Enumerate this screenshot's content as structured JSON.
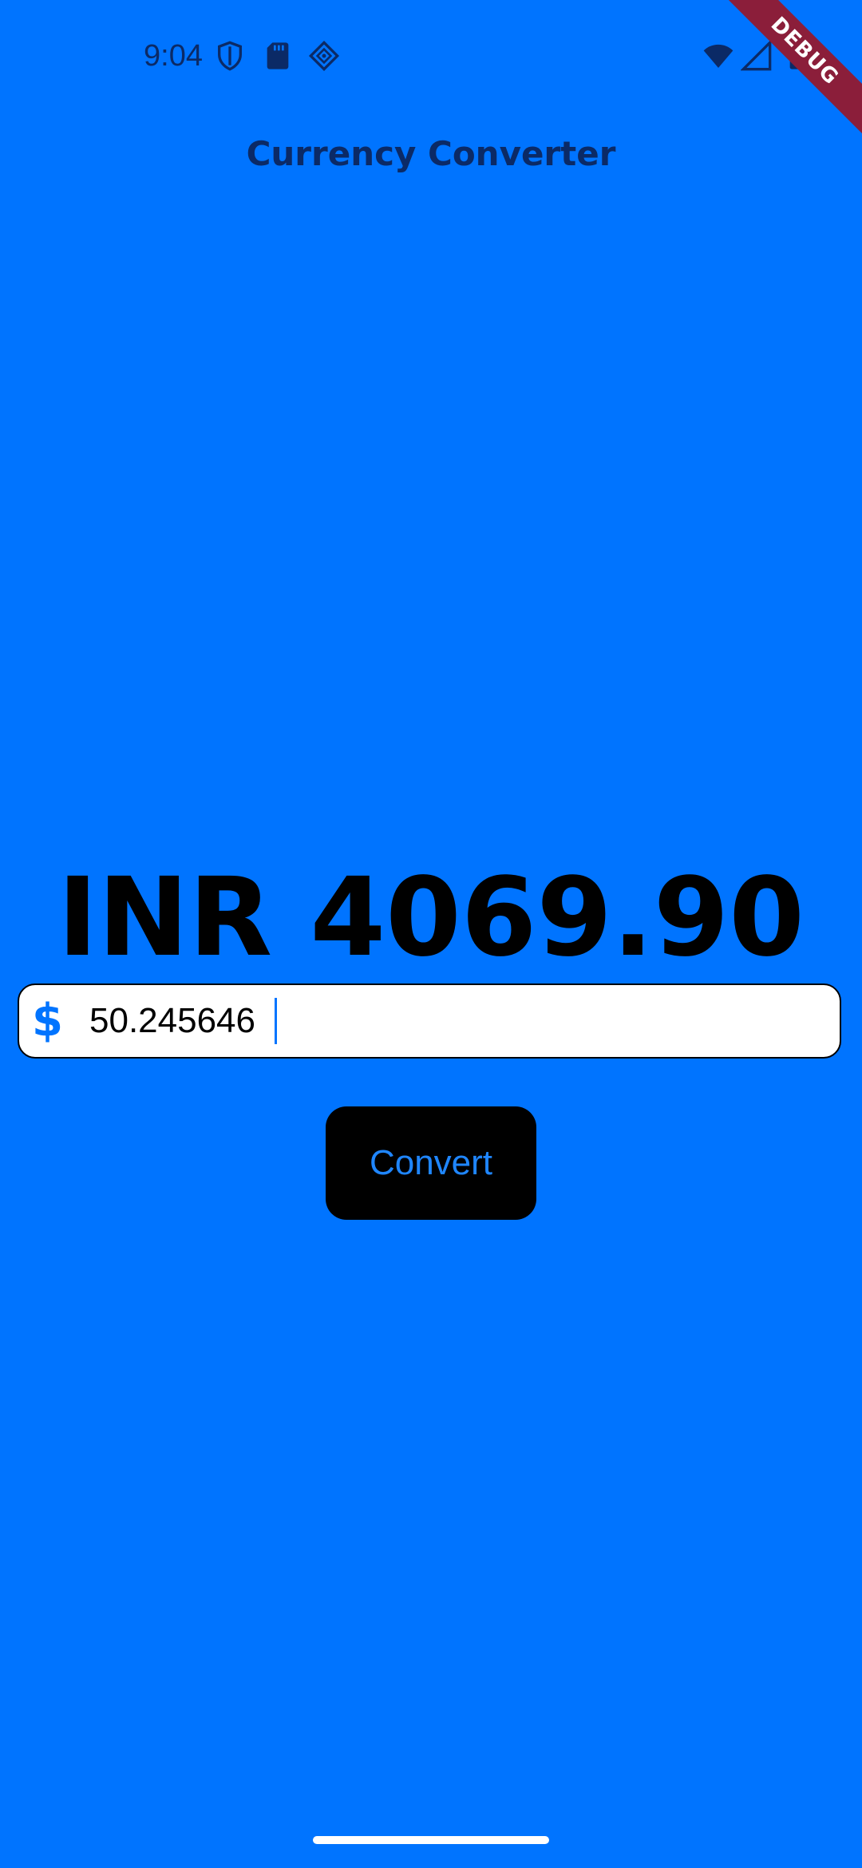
{
  "status_bar": {
    "time": "9:04",
    "icons_left": [
      "shield-icon",
      "sd-card-icon",
      "diamond-grid-icon"
    ],
    "icons_right": [
      "wifi-icon",
      "cellular-icon",
      "battery-icon"
    ]
  },
  "debug_banner": {
    "label": "DEBUG",
    "color": "#8b1e3a"
  },
  "app": {
    "title": "Currency Converter",
    "background_color": "#0074FF"
  },
  "result": {
    "text": "INR 4069.90"
  },
  "amount_field": {
    "prefix_icon": "dollar-icon",
    "prefix_symbol": "$",
    "value": "50.245646"
  },
  "convert_button": {
    "label": "Convert"
  }
}
